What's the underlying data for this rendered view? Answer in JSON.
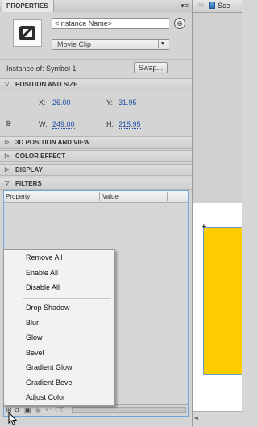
{
  "panel": {
    "title": "PROPERTIES",
    "menu_icon": "panel-menu-icon"
  },
  "header": {
    "instance_name_placeholder": "<Instance Name>",
    "symbol_type": "Movie Clip",
    "instance_of_label": "Instance of:",
    "instance_of_value": "Symbol 1",
    "swap_label": "Swap..."
  },
  "sections": {
    "position_size": "POSITION AND SIZE",
    "position_3d": "3D POSITION AND VIEW",
    "color_effect": "COLOR EFFECT",
    "display": "DISPLAY",
    "filters": "FILTERS"
  },
  "position": {
    "x_label": "X:",
    "x_value": "26.00",
    "y_label": "Y:",
    "y_value": "31.95",
    "w_label": "W:",
    "w_value": "249.00",
    "h_label": "H:",
    "h_value": "215.95"
  },
  "filters_table": {
    "col_property": "Property",
    "col_value": "Value"
  },
  "context_menu": {
    "group1": [
      "Remove All",
      "Enable All",
      "Disable All"
    ],
    "group2": [
      "Drop Shadow",
      "Blur",
      "Glow",
      "Bevel",
      "Gradient Glow",
      "Gradient Bevel",
      "Adjust Color"
    ]
  },
  "document": {
    "scene_label": "Sce",
    "stage_fill_color": "#ffcc00"
  }
}
